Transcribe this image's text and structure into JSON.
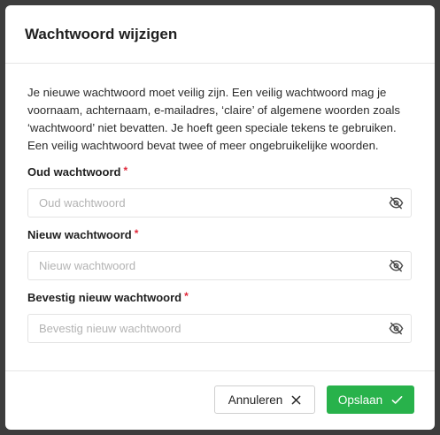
{
  "dialog": {
    "title": "Wachtwoord wijzigen",
    "intro": "Je nieuwe wachtwoord moet veilig zijn. Een veilig wachtwoord mag je voornaam, achternaam, e-mailadres, ‘claire’ of algemene woorden zoals ‘wachtwoord’ niet bevatten. Je hoeft geen speciale tekens te gebruiken. Een veilig wachtwoord bevat twee of meer ongebruikelijke woorden."
  },
  "fields": [
    {
      "label": "Oud wachtwoord",
      "required_mark": "*",
      "value": "",
      "placeholder": "Oud wachtwoord",
      "icon": "eye-off-icon"
    },
    {
      "label": "Nieuw wachtwoord",
      "required_mark": "*",
      "value": "",
      "placeholder": "Nieuw wachtwoord",
      "icon": "eye-off-icon"
    },
    {
      "label": "Bevestig nieuw wachtwoord",
      "required_mark": "*",
      "value": "",
      "placeholder": "Bevestig nieuw wachtwoord",
      "icon": "eye-off-icon"
    }
  ],
  "footer": {
    "cancel_label": "Annuleren",
    "cancel_icon": "close-icon",
    "save_label": "Opslaan",
    "save_icon": "check-icon"
  },
  "colors": {
    "primary": "#28b24b",
    "required": "#e0283a",
    "backdrop": "#3d3d3d"
  }
}
